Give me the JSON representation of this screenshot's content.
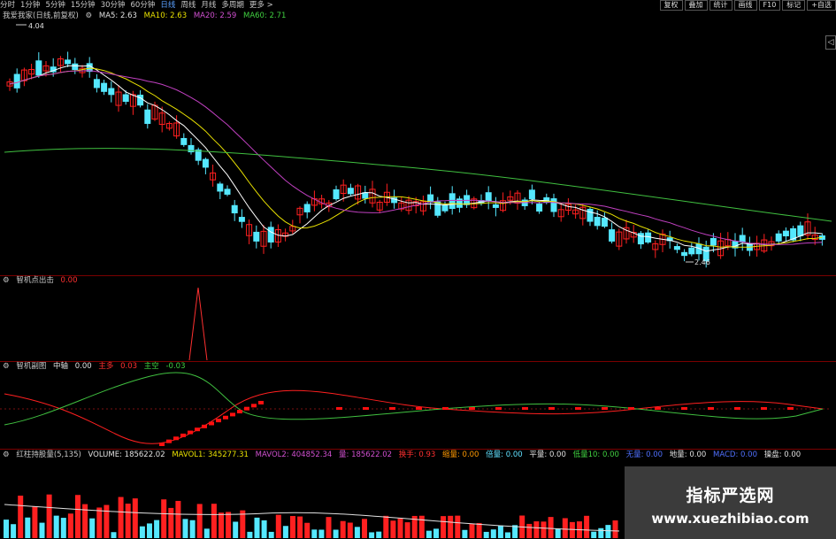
{
  "toolbar": {
    "timeframes": [
      "分时",
      "1分钟",
      "5分钟",
      "15分钟",
      "30分钟",
      "60分钟",
      "日线",
      "周线",
      "月线",
      "多周期",
      "更多 >"
    ],
    "active_index": 6,
    "buttons": [
      "复权",
      "叠加",
      "统计",
      "画线",
      "F10",
      "标记",
      "+自选"
    ],
    "side_button": "◁"
  },
  "main": {
    "title": "我爱我家(日线,前复权)",
    "ma5": "MA5: 2.63",
    "ma10": "MA10: 2.63",
    "ma20": "MA20: 2.59",
    "ma60": "MA60: 2.71",
    "high_label": "4.04",
    "low_label": "2.46"
  },
  "panel2": {
    "title": "智机点出击",
    "value": "0.00"
  },
  "panel3": {
    "title": "智机副图",
    "mid_label": "中轴",
    "mid_value": "0.00",
    "main_label": "主多",
    "main_value": "0.03",
    "empty_label": "主空",
    "empty_value": "-0.03"
  },
  "panel4": {
    "title": "红柱持股量(5,135)",
    "volume": "VOLUME: 185622.02",
    "mavol1": "MAVOL1: 345277.31",
    "mavol2": "MAVOL2: 404852.34",
    "liang": "量: 185622.02",
    "huanshou": "换手: 0.93",
    "suoliang": "缩量: 0.00",
    "beiliang": "倍量: 0.00",
    "pingliang": "平量: 0.00",
    "diliang": "低量10: 0.00",
    "wuliang": "无量: 0.00",
    "gaoliang": "地量: 0.00",
    "macd": "MACD: 0.00",
    "caopan": "操盘: 0.00"
  },
  "watermark": {
    "title": "指标严选网",
    "url": "www.xuezhibiao.com"
  },
  "colors": {
    "up": "#ff2020",
    "down": "#55e8ff",
    "ma5": "#ffffff",
    "ma10": "#e8e000",
    "ma20": "#c040c0",
    "ma60": "#40c040"
  }
}
